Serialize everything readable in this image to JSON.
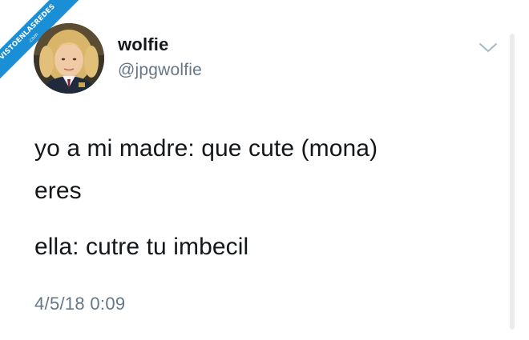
{
  "watermark": {
    "text": "VISTOENLASREDES",
    "domain": ".com",
    "color": "#1b8fd6"
  },
  "tweet": {
    "author": {
      "display_name": "wolfie",
      "handle": "@jpgwolfie",
      "avatar_icon": "avatar-photo-icon"
    },
    "menu_icon": "chevron-down-icon",
    "lines": [
      "yo a mi madre: que cute (mona)",
      "eres",
      "ella: cutre tu imbecil"
    ],
    "timestamp": "4/5/18 0:09"
  },
  "colors": {
    "text": "#14171a",
    "secondary": "#657786",
    "background": "#ffffff"
  }
}
